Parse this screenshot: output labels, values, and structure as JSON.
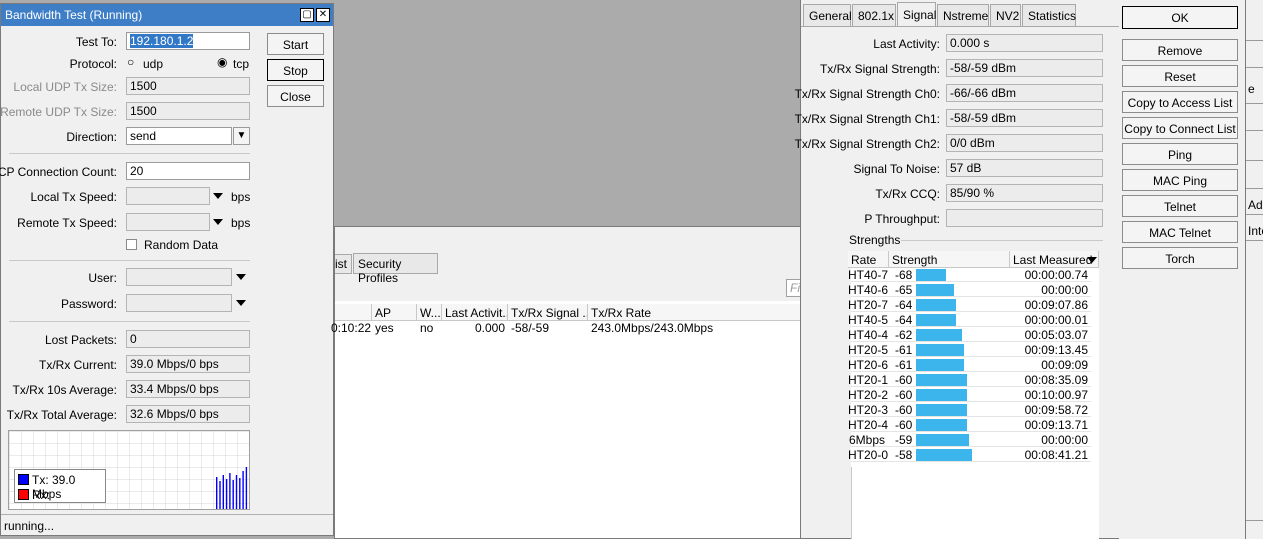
{
  "bw": {
    "title": "Bandwidth Test (Running)",
    "test_to_label": "Test To:",
    "test_to_value": "192.180.1.2",
    "protocol_label": "Protocol:",
    "protocol_udp": "udp",
    "protocol_tcp": "tcp",
    "local_udp_label": "Local UDP Tx Size:",
    "local_udp_value": "1500",
    "remote_udp_label": "Remote UDP Tx Size:",
    "remote_udp_value": "1500",
    "direction_label": "Direction:",
    "direction_value": "send",
    "tcp_count_label": "TCP Connection Count:",
    "tcp_count_value": "20",
    "local_speed_label": "Local Tx Speed:",
    "remote_speed_label": "Remote Tx Speed:",
    "bps": "bps",
    "random_data_label": "Random Data",
    "user_label": "User:",
    "password_label": "Password:",
    "lost_packets_label": "Lost Packets:",
    "lost_packets_value": "0",
    "current_label": "Tx/Rx Current:",
    "current_value": "39.0 Mbps/0 bps",
    "avg10_label": "Tx/Rx 10s Average:",
    "avg10_value": "33.4 Mbps/0 bps",
    "total_label": "Tx/Rx Total Average:",
    "total_value": "32.6 Mbps/0 bps",
    "legend_tx": "Tx:  39.0 Mbps",
    "legend_rx": "Rx:",
    "status": "running...",
    "start": "Start",
    "stop": "Stop",
    "close": "Close",
    "tx_color": "#0000ff",
    "rx_color": "#ff0000"
  },
  "reg": {
    "tab_partial": "ist",
    "tab_security": "Security Profiles",
    "find_placeholder": "Find",
    "cols": [
      "AP",
      "W...",
      "Last Activit...",
      "Tx/Rx Signal ...",
      "Tx/Rx Rate"
    ],
    "row": {
      "uptime": "0:10:22",
      "ap": "yes",
      "w": "no",
      "last_activity": "0.000",
      "signal": "-58/-59",
      "rate": "243.0Mbps/243.0Mbps"
    }
  },
  "sig": {
    "tabs": [
      "General",
      "802.1x",
      "Signal",
      "Nstreme",
      "NV2",
      "Statistics"
    ],
    "fields": [
      {
        "label": "Last Activity:",
        "value": "0.000 s"
      },
      {
        "label": "Tx/Rx Signal Strength:",
        "value": "-58/-59 dBm"
      },
      {
        "label": "Tx/Rx Signal Strength Ch0:",
        "value": "-66/-66 dBm"
      },
      {
        "label": "Tx/Rx Signal Strength Ch1:",
        "value": "-58/-59 dBm"
      },
      {
        "label": "Tx/Rx Signal Strength Ch2:",
        "value": "0/0 dBm"
      },
      {
        "label": "Signal To Noise:",
        "value": "57 dB"
      },
      {
        "label": "Tx/Rx CCQ:",
        "value": "85/90 %"
      },
      {
        "label": "P Throughput:",
        "value": ""
      }
    ],
    "strengths_title": "Strengths",
    "cols": [
      "Rate",
      "Strength",
      "Last Measured"
    ],
    "rows": [
      {
        "rate": "HT40-7",
        "strength": -68,
        "time": "00:00:00.74"
      },
      {
        "rate": "HT40-6",
        "strength": -65,
        "time": "00:00:00"
      },
      {
        "rate": "HT20-7",
        "strength": -64,
        "time": "00:09:07.86"
      },
      {
        "rate": "HT40-5",
        "strength": -64,
        "time": "00:00:00.01"
      },
      {
        "rate": "HT40-4",
        "strength": -62,
        "time": "00:05:03.07"
      },
      {
        "rate": "HT20-5",
        "strength": -61,
        "time": "00:09:13.45"
      },
      {
        "rate": "HT20-6",
        "strength": -61,
        "time": "00:09:09"
      },
      {
        "rate": "HT20-1",
        "strength": -60,
        "time": "00:08:35.09"
      },
      {
        "rate": "HT20-2",
        "strength": -60,
        "time": "00:10:00.97"
      },
      {
        "rate": "HT20-3",
        "strength": -60,
        "time": "00:09:58.72"
      },
      {
        "rate": "HT20-4",
        "strength": -60,
        "time": "00:09:13.71"
      },
      {
        "rate": "6Mbps",
        "strength": -59,
        "time": "00:00:00"
      },
      {
        "rate": "HT20-0",
        "strength": -58,
        "time": "00:08:41.21"
      }
    ],
    "bar_color": "#3bb5ec",
    "buttons": [
      "OK",
      "Remove",
      "Reset",
      "Copy to Access List",
      "Copy to Connect List",
      "Ping",
      "MAC Ping",
      "Telnet",
      "MAC Telnet",
      "Torch"
    ]
  },
  "far": {
    "frag1": "e",
    "frag2": "Addr",
    "frag3": "Inter"
  }
}
